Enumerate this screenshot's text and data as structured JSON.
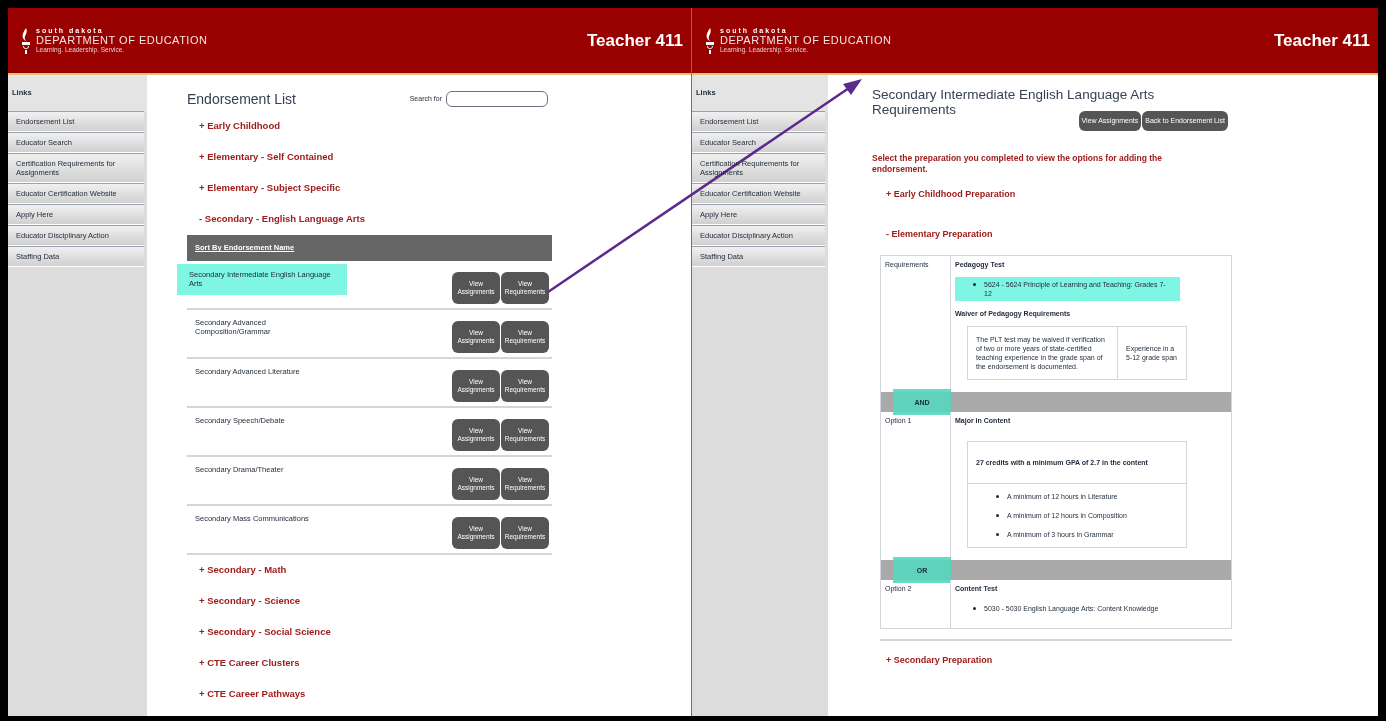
{
  "screens": [
    {
      "header": {
        "logo_top": "south dakota",
        "logo_main": "DEPARTMENT OF EDUCATION",
        "logo_tagline": "Learning. Leadership. Service.",
        "title": "Teacher 411"
      },
      "sidebar": {
        "heading": "Links",
        "items": [
          "Endorsement List",
          "Educator Search",
          "Certification Requirements for Assignments",
          "Educator Certification Website",
          "Apply Here",
          "Educator Disciplinary Action",
          "Staffing Data"
        ]
      },
      "kind": "endorsement_list",
      "title": "Endorsement List",
      "search_label": "Search for",
      "categories": [
        {
          "label": "+ Early Childhood"
        },
        {
          "label": "+ Elementary - Self Contained"
        },
        {
          "label": "+ Elementary - Subject Specific"
        },
        {
          "label": "- Secondary - English Language Arts",
          "sort_header": "Sort By Endorsement Name",
          "rows": [
            {
              "name": "Secondary Intermediate English Language Arts",
              "highlighted": true,
              "buttons": [
                "View Assignments",
                "View Requirements"
              ]
            },
            {
              "name": "Secondary Advanced Composition/Grammar",
              "highlighted": false,
              "buttons": [
                "View Assignments",
                "View Requirements"
              ]
            },
            {
              "name": "Secondary Advanced Literature",
              "highlighted": false,
              "buttons": [
                "View Assignments",
                "View Requirements"
              ]
            },
            {
              "name": "Secondary Speech/Debate",
              "highlighted": false,
              "buttons": [
                "View Assignments",
                "View Requirements"
              ]
            },
            {
              "name": "Secondary Drama/Theater",
              "highlighted": false,
              "buttons": [
                "View Assignments",
                "View Requirements"
              ]
            },
            {
              "name": "Secondary Mass Communications",
              "highlighted": false,
              "buttons": [
                "View Assignments",
                "View Requirements"
              ]
            }
          ]
        },
        {
          "label": "+ Secondary - Math"
        },
        {
          "label": "+ Secondary - Science"
        },
        {
          "label": "+ Secondary - Social Science"
        },
        {
          "label": "+ CTE Career Clusters"
        },
        {
          "label": "+ CTE Career Pathways"
        }
      ]
    },
    {
      "header": {
        "logo_top": "south dakota",
        "logo_main": "DEPARTMENT OF EDUCATION",
        "logo_tagline": "Learning. Leadership. Service.",
        "title": "Teacher 411"
      },
      "sidebar": {
        "heading": "Links",
        "items": [
          "Endorsement List",
          "Educator Search",
          "Certification Requirements for Assignments",
          "Educator Certification Website",
          "Apply Here",
          "Educator Disciplinary Action",
          "Staffing Data"
        ]
      },
      "kind": "requirements",
      "title": "Secondary Intermediate English Language Arts Requirements",
      "buttons": [
        "View Assignments",
        "Back to Endorsement List"
      ],
      "instruction": "Select the preparation you completed to view the options for adding the endorsement.",
      "sections": [
        {
          "label": "+ Early Childhood Preparation"
        },
        {
          "label": "- Elementary Preparation",
          "rows": [
            {
              "kind": "requirement",
              "label": "Requirements",
              "heading": "Pedagogy Test",
              "bullets": [
                {
                  "text": "5624 - 5624 Principle of Learning and Teaching: Grades 7-12",
                  "highlighted": true
                }
              ],
              "sub_heading": "Waiver of Pedagogy Requirements",
              "box_cells": [
                "The PLT test may be waived if verification of two or more years of state-certified teaching experience in the grade span of the endorsement is documented.",
                "Experience in a 5-12 grade span"
              ]
            },
            {
              "kind": "connector",
              "label": "AND",
              "highlighted": true
            },
            {
              "kind": "option",
              "label": "Option 1",
              "heading": "Major in Content",
              "box_title": "27 credits with a minimum GPA of 2.7 in the content",
              "box_bullets": [
                "A minimum of 12 hours in Literature",
                "A minimum of 12 hours in Composition",
                "A minimum of 3 hours in Grammar"
              ]
            },
            {
              "kind": "connector",
              "label": "OR",
              "highlighted": true
            },
            {
              "kind": "requirement",
              "label": "Option 2",
              "heading": "Content Test",
              "bullets": [
                {
                  "text": "5030 - 5030 English Language Arts: Content Knowledge",
                  "highlighted": false
                }
              ]
            }
          ]
        },
        {
          "label": "+ Secondary Preparation"
        }
      ]
    }
  ]
}
